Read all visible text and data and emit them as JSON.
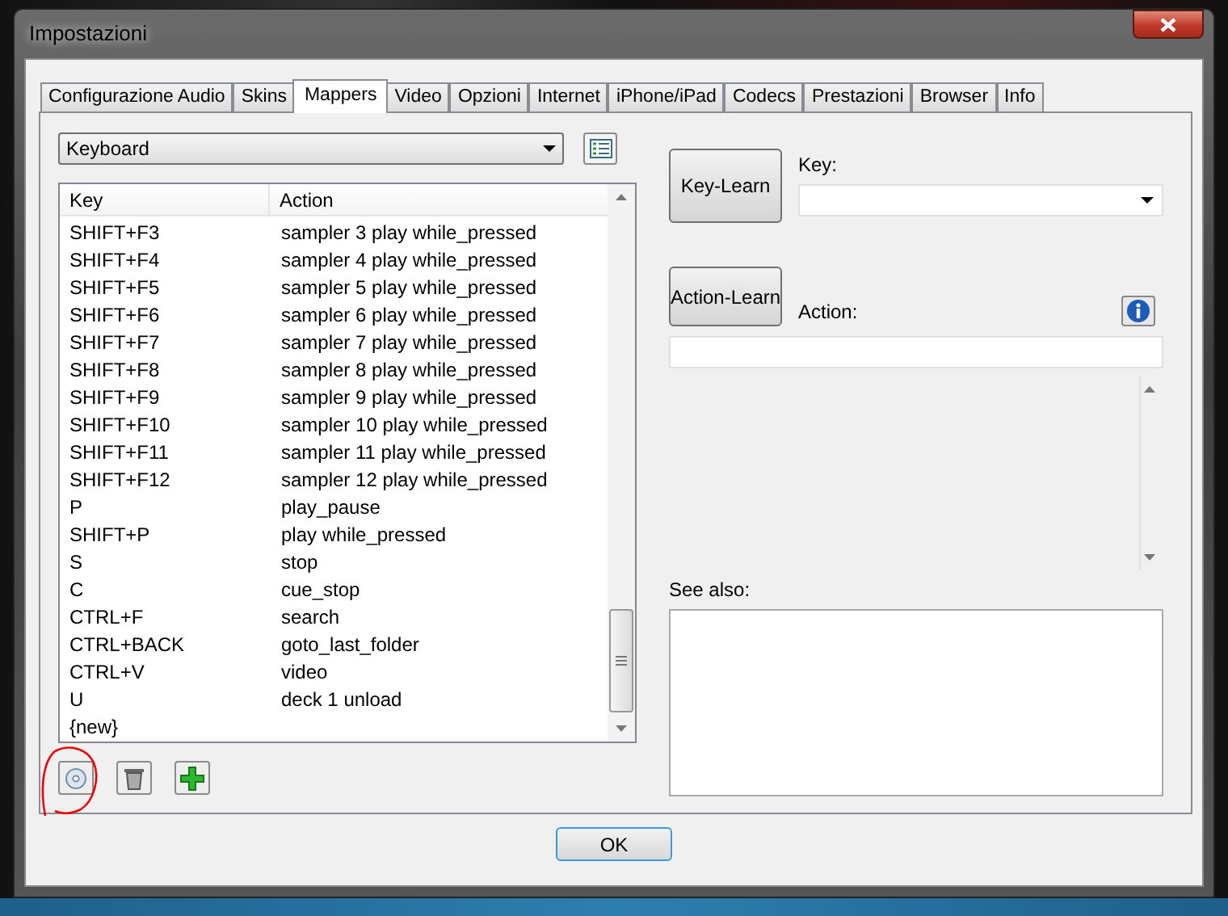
{
  "window": {
    "title": "Impostazioni"
  },
  "tabs": [
    {
      "label": "Configurazione Audio",
      "selected": false
    },
    {
      "label": "Skins",
      "selected": false
    },
    {
      "label": "Mappers",
      "selected": true
    },
    {
      "label": "Video",
      "selected": false
    },
    {
      "label": "Opzioni",
      "selected": false
    },
    {
      "label": "Internet",
      "selected": false
    },
    {
      "label": "iPhone/iPad",
      "selected": false
    },
    {
      "label": "Codecs",
      "selected": false
    },
    {
      "label": "Prestazioni",
      "selected": false
    },
    {
      "label": "Browser",
      "selected": false
    },
    {
      "label": "Info",
      "selected": false
    }
  ],
  "mapper_select": {
    "value": "Keyboard"
  },
  "table": {
    "columns": [
      "Key",
      "Action"
    ],
    "rows": [
      {
        "key": "SHIFT+F3",
        "action": "sampler 3 play while_pressed"
      },
      {
        "key": "SHIFT+F4",
        "action": "sampler 4 play while_pressed"
      },
      {
        "key": "SHIFT+F5",
        "action": "sampler 5 play while_pressed"
      },
      {
        "key": "SHIFT+F6",
        "action": "sampler 6 play while_pressed"
      },
      {
        "key": "SHIFT+F7",
        "action": "sampler 7 play while_pressed"
      },
      {
        "key": "SHIFT+F8",
        "action": "sampler 8 play while_pressed"
      },
      {
        "key": "SHIFT+F9",
        "action": "sampler 9 play while_pressed"
      },
      {
        "key": "SHIFT+F10",
        "action": "sampler 10 play while_pressed"
      },
      {
        "key": "SHIFT+F11",
        "action": "sampler 11 play while_pressed"
      },
      {
        "key": "SHIFT+F12",
        "action": "sampler 12 play while_pressed"
      },
      {
        "key": "P",
        "action": "play_pause"
      },
      {
        "key": "SHIFT+P",
        "action": "play while_pressed"
      },
      {
        "key": "S",
        "action": "stop"
      },
      {
        "key": "C",
        "action": "cue_stop"
      },
      {
        "key": "CTRL+F",
        "action": "search"
      },
      {
        "key": "CTRL+BACK",
        "action": "goto_last_folder"
      },
      {
        "key": "CTRL+V",
        "action": "video"
      },
      {
        "key": "U",
        "action": "deck 1 unload"
      }
    ],
    "new_row": "{new}"
  },
  "key_learn": {
    "button": "Key-Learn",
    "label": "Key:"
  },
  "action_learn": {
    "button": "Action-Learn",
    "label": "Action:"
  },
  "see_also": {
    "label": "See also:"
  },
  "ok_button": "OK"
}
